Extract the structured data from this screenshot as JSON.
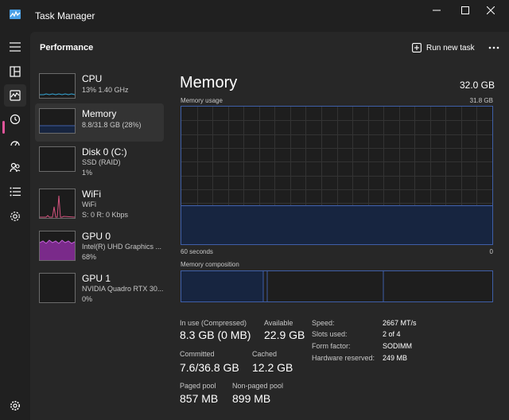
{
  "window": {
    "title": "Task Manager"
  },
  "header": {
    "title": "Performance",
    "run_task_label": "Run new task"
  },
  "sidebar_items": [
    {
      "title": "CPU",
      "line1": "13%  1.40 GHz",
      "line2": ""
    },
    {
      "title": "Memory",
      "line1": "8.8/31.8 GB (28%)",
      "line2": ""
    },
    {
      "title": "Disk 0 (C:)",
      "line1": "SSD (RAID)",
      "line2": "1%"
    },
    {
      "title": "WiFi",
      "line1": "WiFi",
      "line2": "S: 0 R: 0 Kbps"
    },
    {
      "title": "GPU 0",
      "line1": "Intel(R) UHD Graphics ...",
      "line2": "68%"
    },
    {
      "title": "GPU 1",
      "line1": "NVIDIA Quadro RTX 30...",
      "line2": "0%"
    }
  ],
  "memory": {
    "title": "Memory",
    "total": "32.0 GB",
    "usage_label": "Memory usage",
    "usage_max": "31.8 GB",
    "time_label": "60 seconds",
    "time_end": "0",
    "composition_label": "Memory composition",
    "usage_fraction": 0.28
  },
  "stats": {
    "in_use_label": "In use (Compressed)",
    "in_use_value": "8.3 GB (0 MB)",
    "available_label": "Available",
    "available_value": "22.9 GB",
    "committed_label": "Committed",
    "committed_value": "7.6/36.8 GB",
    "cached_label": "Cached",
    "cached_value": "12.2 GB",
    "paged_label": "Paged pool",
    "paged_value": "857 MB",
    "nonpaged_label": "Non-paged pool",
    "nonpaged_value": "899 MB"
  },
  "specs": [
    {
      "label": "Speed:",
      "value": "2667 MT/s"
    },
    {
      "label": "Slots used:",
      "value": "2 of 4"
    },
    {
      "label": "Form factor:",
      "value": "SODIMM"
    },
    {
      "label": "Hardware reserved:",
      "value": "249 MB"
    }
  ],
  "colors": {
    "accent": "#e0559a",
    "memory_line": "#3f5fa8",
    "memory_fill": "#172540",
    "cpu_line": "#36a8d8",
    "wifi_line": "#d3537e",
    "gpu_fill": "#7a2a8a"
  },
  "icons": {
    "rail": [
      "menu-icon",
      "processes-icon",
      "performance-icon",
      "app-history-icon",
      "startup-apps-icon",
      "users-icon",
      "details-icon",
      "services-icon",
      "settings-icon"
    ]
  }
}
